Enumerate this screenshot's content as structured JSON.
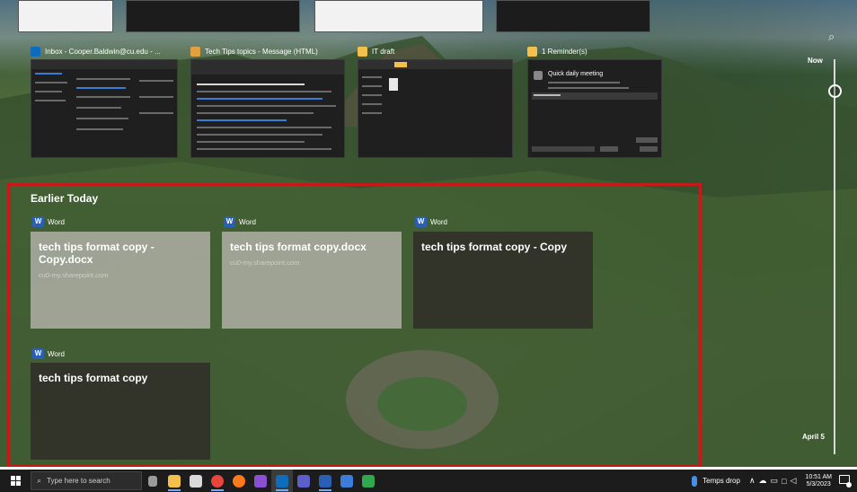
{
  "windows": [
    {
      "title": "Inbox - Cooper.Baldwin@cu.edu - ...",
      "icon": "outlook-icon",
      "icon_color": "#0f6cbd"
    },
    {
      "title": "Tech Tips topics - Message (HTML)",
      "icon": "mail-message-icon",
      "icon_color": "#e0a040"
    },
    {
      "title": "IT draft",
      "icon": "folder-icon",
      "icon_color": "#f3c04b"
    },
    {
      "title": "1 Reminder(s)",
      "icon": "bell-icon",
      "icon_color": "#f3c04b"
    }
  ],
  "reminder_window": {
    "subject": "Quick daily meeting"
  },
  "timeline": {
    "now_label": "Now",
    "end_label": "April 5"
  },
  "earlier_today": {
    "title": "Earlier Today",
    "cards": [
      {
        "app": "Word",
        "title": "tech tips format copy - Copy.docx",
        "subtitle": "cu0-my.sharepoint.com",
        "style": "light"
      },
      {
        "app": "Word",
        "title": "tech tips format copy.docx",
        "subtitle": "cu0-my.sharepoint.com",
        "style": "light"
      },
      {
        "app": "Word",
        "title": "tech tips format copy - Copy",
        "subtitle": "",
        "style": "dark"
      },
      {
        "app": "Word",
        "title": "tech tips format copy",
        "subtitle": "",
        "style": "dark"
      }
    ]
  },
  "taskbar": {
    "search_placeholder": "Type here to search",
    "weather": "Temps drop",
    "time": "10:51 AM",
    "date": "5/3/2023",
    "apps": [
      {
        "name": "task-view",
        "color": "#9a9a9a"
      },
      {
        "name": "file-explorer",
        "color": "#f3c04b"
      },
      {
        "name": "calculator",
        "color": "#d9d9d9"
      },
      {
        "name": "chrome",
        "color": "#e8453c"
      },
      {
        "name": "firefox",
        "color": "#ff7a1a"
      },
      {
        "name": "onenote",
        "color": "#8b4fd1"
      },
      {
        "name": "outlook",
        "color": "#0f6cbd"
      },
      {
        "name": "teams",
        "color": "#5b5fc7"
      },
      {
        "name": "word",
        "color": "#2b5fb4"
      },
      {
        "name": "app-blue",
        "color": "#3b7dd8"
      },
      {
        "name": "app-green",
        "color": "#2fa84f"
      }
    ]
  }
}
